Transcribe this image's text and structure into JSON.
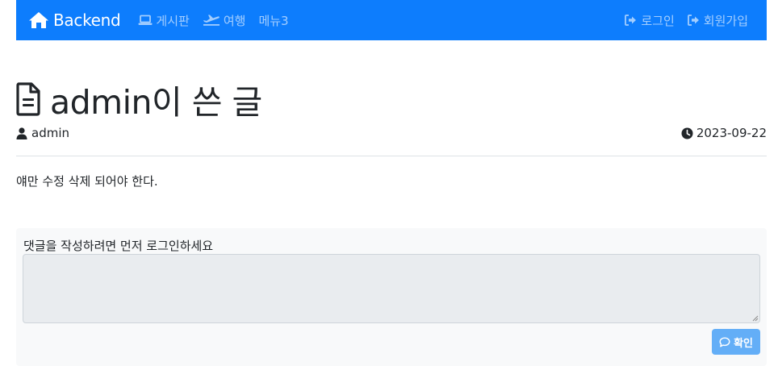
{
  "navbar": {
    "brand": "Backend",
    "left_items": [
      {
        "label": "게시판",
        "icon": "laptop-icon"
      },
      {
        "label": "여행",
        "icon": "plane-icon"
      },
      {
        "label": "메뉴3",
        "icon": ""
      }
    ],
    "right_items": [
      {
        "label": "로그인",
        "icon": "sign-in-icon"
      },
      {
        "label": "회원가입",
        "icon": "sign-in-icon"
      }
    ]
  },
  "post": {
    "title": "admin이 쓴 글",
    "author": "admin",
    "date": "2023-09-22",
    "body": "얘만 수정 삭제 되어야 한다."
  },
  "comment": {
    "label": "댓글을 작성하려면 먼저 로그인하세요",
    "value": "",
    "submit_label": "확인"
  },
  "colors": {
    "navbar_bg": "#0d7dfd",
    "button_bg": "#63aef7",
    "comment_bg": "#f8f9fa"
  }
}
